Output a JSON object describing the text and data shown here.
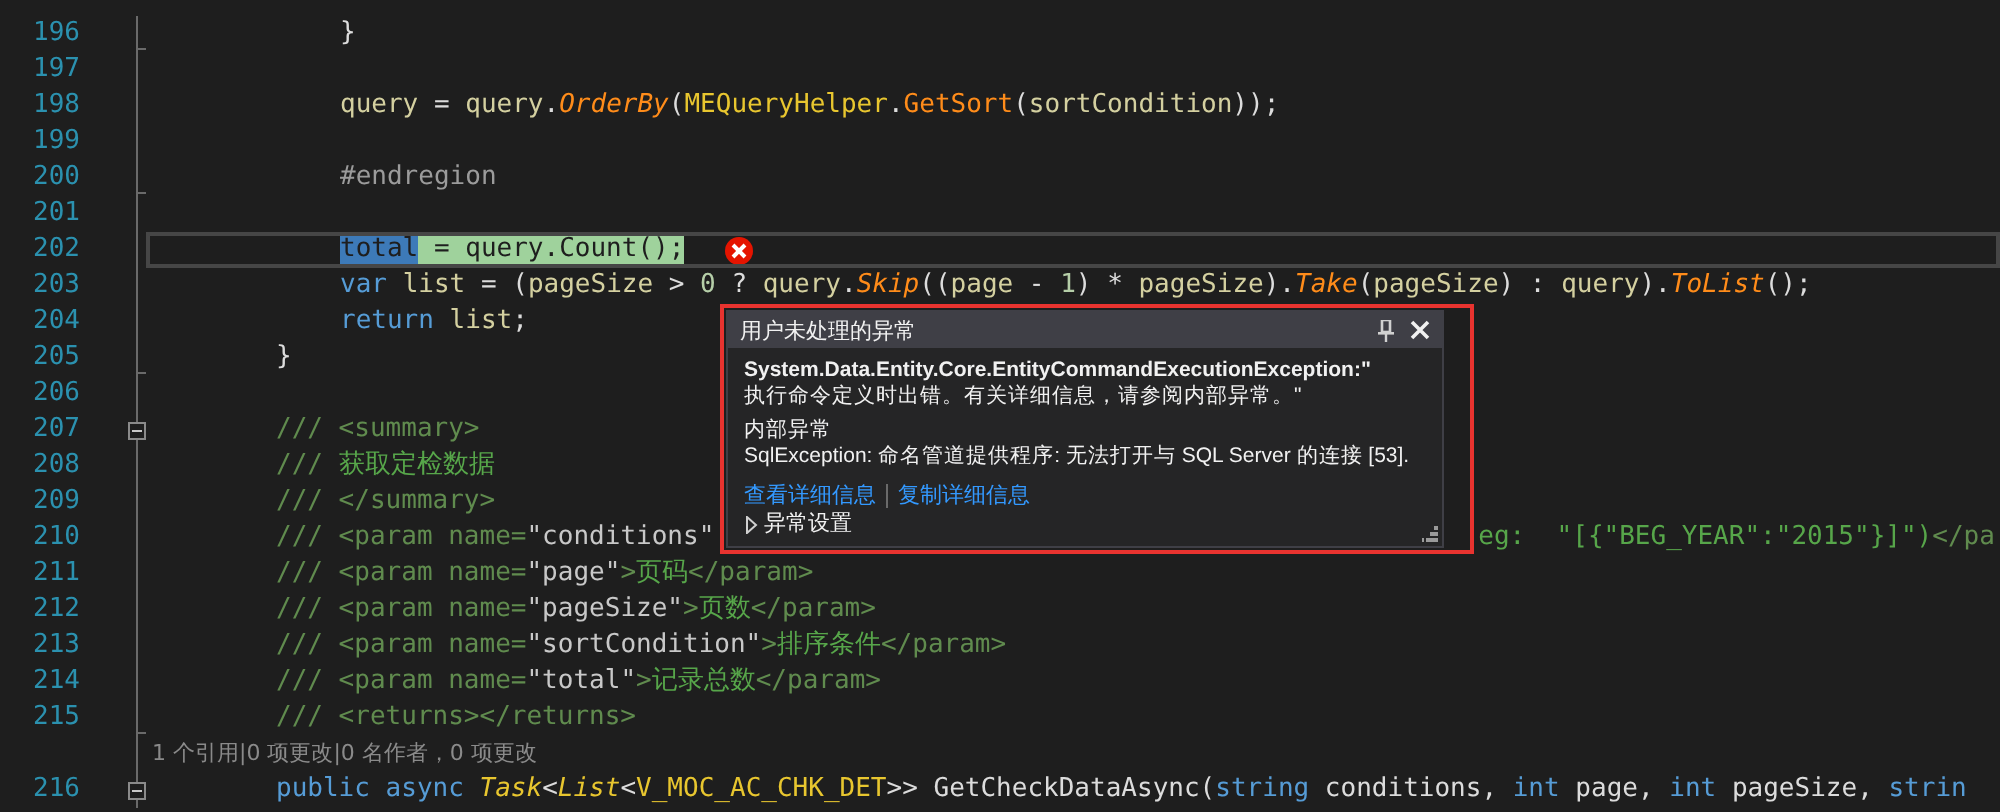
{
  "editor": {
    "lines": [
      {
        "kind": "body",
        "number": "196",
        "collapsible": false,
        "block_end": true,
        "tokens": [
          {
            "kind": "plain",
            "text": "}"
          }
        ]
      },
      {
        "kind": "blank",
        "number": "197",
        "collapsible": false,
        "block_end": false
      },
      {
        "kind": "body",
        "number": "198",
        "collapsible": false,
        "block_end": false,
        "tokens": [
          {
            "kind": "var",
            "text": "query"
          },
          {
            "kind": "plain",
            "text": " = "
          },
          {
            "kind": "var",
            "text": "query"
          },
          {
            "kind": "plain",
            "text": "."
          },
          {
            "kind": "ext",
            "text": "OrderBy"
          },
          {
            "kind": "plain",
            "text": "("
          },
          {
            "kind": "cls",
            "text": "MEQueryHelper"
          },
          {
            "kind": "plain",
            "text": "."
          },
          {
            "kind": "method",
            "text": "GetSort"
          },
          {
            "kind": "plain",
            "text": "("
          },
          {
            "kind": "var",
            "text": "sortCondition"
          },
          {
            "kind": "plain",
            "text": "));"
          }
        ]
      },
      {
        "kind": "blank",
        "number": "199",
        "collapsible": false,
        "block_end": false
      },
      {
        "kind": "body",
        "number": "200",
        "collapsible": false,
        "block_end": true,
        "tokens": [
          {
            "kind": "pre",
            "text": "#endregion"
          }
        ]
      },
      {
        "kind": "blank",
        "number": "201",
        "collapsible": false,
        "block_end": false
      },
      {
        "kind": "current",
        "number": "202",
        "collapsible": false,
        "block_end": false,
        "error": true,
        "tokens": [
          {
            "kind": "sel",
            "text": "total"
          },
          {
            "kind": "stmt",
            "text": " = query.Count();"
          }
        ]
      },
      {
        "kind": "body",
        "number": "203",
        "collapsible": false,
        "block_end": false,
        "tokens": [
          {
            "kind": "kw",
            "text": "var "
          },
          {
            "kind": "var",
            "text": "list"
          },
          {
            "kind": "plain",
            "text": " = ("
          },
          {
            "kind": "var",
            "text": "pageSize"
          },
          {
            "kind": "plain",
            "text": " > "
          },
          {
            "kind": "num",
            "text": "0"
          },
          {
            "kind": "plain",
            "text": " ? "
          },
          {
            "kind": "var",
            "text": "query"
          },
          {
            "kind": "plain",
            "text": "."
          },
          {
            "kind": "ext",
            "text": "Skip"
          },
          {
            "kind": "plain",
            "text": "(("
          },
          {
            "kind": "var",
            "text": "page"
          },
          {
            "kind": "plain",
            "text": " - "
          },
          {
            "kind": "num",
            "text": "1"
          },
          {
            "kind": "plain",
            "text": ") * "
          },
          {
            "kind": "var",
            "text": "pageSize"
          },
          {
            "kind": "plain",
            "text": ")."
          },
          {
            "kind": "ext",
            "text": "Take"
          },
          {
            "kind": "plain",
            "text": "("
          },
          {
            "kind": "var",
            "text": "pageSize"
          },
          {
            "kind": "plain",
            "text": ") : "
          },
          {
            "kind": "var",
            "text": "query"
          },
          {
            "kind": "plain",
            "text": ")."
          },
          {
            "kind": "ext",
            "text": "ToList"
          },
          {
            "kind": "plain",
            "text": "();"
          }
        ]
      },
      {
        "kind": "body",
        "number": "204",
        "collapsible": false,
        "block_end": false,
        "tokens": [
          {
            "kind": "kw",
            "text": "return "
          },
          {
            "kind": "var",
            "text": "list"
          },
          {
            "kind": "plain",
            "text": ";"
          }
        ]
      },
      {
        "kind": "member",
        "number": "205",
        "collapsible": false,
        "block_end": true,
        "tokens": [
          {
            "kind": "plain",
            "text": "}"
          }
        ]
      },
      {
        "kind": "blank",
        "number": "206",
        "collapsible": false,
        "block_end": false
      },
      {
        "kind": "member",
        "number": "207",
        "collapsible": true,
        "block_end": false,
        "tokens": [
          {
            "kind": "doctag",
            "text": "/// <summary>"
          }
        ]
      },
      {
        "kind": "member",
        "number": "208",
        "collapsible": false,
        "block_end": false,
        "tokens": [
          {
            "kind": "doctag",
            "text": "/// "
          },
          {
            "kind": "doc",
            "text": "获取定检数据"
          }
        ]
      },
      {
        "kind": "member",
        "number": "209",
        "collapsible": false,
        "block_end": false,
        "tokens": [
          {
            "kind": "doctag",
            "text": "/// </summary>"
          }
        ]
      },
      {
        "kind": "member",
        "number": "210",
        "collapsible": false,
        "block_end": false,
        "tokens": [
          {
            "kind": "doctag",
            "text": "/// <param name="
          },
          {
            "kind": "docattr",
            "text": "\"conditions\""
          }
        ],
        "tail": [
          {
            "kind": "doc",
            "text": "eg:  \"[{\"BEG_YEAR\":\"2015\"}]\")"
          },
          {
            "kind": "doctag",
            "text": "</pa"
          }
        ]
      },
      {
        "kind": "member",
        "number": "211",
        "collapsible": false,
        "block_end": false,
        "tokens": [
          {
            "kind": "doctag",
            "text": "/// <param name="
          },
          {
            "kind": "docattr",
            "text": "\"page\""
          },
          {
            "kind": "doctag",
            "text": ">"
          },
          {
            "kind": "doc",
            "text": "页码"
          },
          {
            "kind": "doctag",
            "text": "</param>"
          }
        ]
      },
      {
        "kind": "member",
        "number": "212",
        "collapsible": false,
        "block_end": false,
        "tokens": [
          {
            "kind": "doctag",
            "text": "/// <param name="
          },
          {
            "kind": "docattr",
            "text": "\"pageSize\""
          },
          {
            "kind": "doctag",
            "text": ">"
          },
          {
            "kind": "doc",
            "text": "页数"
          },
          {
            "kind": "doctag",
            "text": "</param>"
          }
        ]
      },
      {
        "kind": "member",
        "number": "213",
        "collapsible": false,
        "block_end": false,
        "tokens": [
          {
            "kind": "doctag",
            "text": "/// <param name="
          },
          {
            "kind": "docattr",
            "text": "\"sortCondition\""
          },
          {
            "kind": "doctag",
            "text": ">"
          },
          {
            "kind": "doc",
            "text": "排序条件"
          },
          {
            "kind": "doctag",
            "text": "</param>"
          }
        ]
      },
      {
        "kind": "member",
        "number": "214",
        "collapsible": false,
        "block_end": false,
        "tokens": [
          {
            "kind": "doctag",
            "text": "/// <param name="
          },
          {
            "kind": "docattr",
            "text": "\"total\""
          },
          {
            "kind": "doctag",
            "text": ">"
          },
          {
            "kind": "doc",
            "text": "记录总数"
          },
          {
            "kind": "doctag",
            "text": "</param>"
          }
        ]
      },
      {
        "kind": "member",
        "number": "215",
        "collapsible": false,
        "block_end": true,
        "tokens": [
          {
            "kind": "doctag",
            "text": "/// <returns></returns>"
          }
        ]
      },
      {
        "kind": "codelens",
        "text": "1 个引用|0 项更改|0 名作者，0 项更改"
      },
      {
        "kind": "member",
        "number": "216",
        "collapsible": true,
        "block_end": false,
        "tokens": [
          {
            "kind": "kw",
            "text": "public async "
          },
          {
            "kind": "iface",
            "text": "Task"
          },
          {
            "kind": "plain",
            "text": "<"
          },
          {
            "kind": "iface",
            "text": "List"
          },
          {
            "kind": "plain",
            "text": "<"
          },
          {
            "kind": "cls",
            "text": "V_MOC_AC_CHK_DET"
          },
          {
            "kind": "plain",
            "text": ">> GetCheckDataAsync("
          },
          {
            "kind": "kw",
            "text": "string"
          },
          {
            "kind": "plain",
            "text": " conditions, "
          },
          {
            "kind": "kw",
            "text": "int"
          },
          {
            "kind": "plain",
            "text": " page, "
          },
          {
            "kind": "kw",
            "text": "int"
          },
          {
            "kind": "plain",
            "text": " pageSize, "
          },
          {
            "kind": "kw",
            "text": "strin"
          }
        ]
      }
    ]
  },
  "exception_popup": {
    "title": "用户未处理的异常",
    "exception_type": "System.Data.Entity.Core.EntityCommandExecutionException:\"",
    "message": "执行命令定义时出错。有关详细信息，请参阅内部异常。\"",
    "inner_label": "内部异常",
    "inner_message": "SqlException: 命名管道提供程序: 无法打开与 SQL Server 的连接 [53].",
    "links": [
      "查看详细信息",
      "复制详细信息"
    ],
    "settings": {
      "label": "异常设置",
      "expanded": false
    }
  }
}
